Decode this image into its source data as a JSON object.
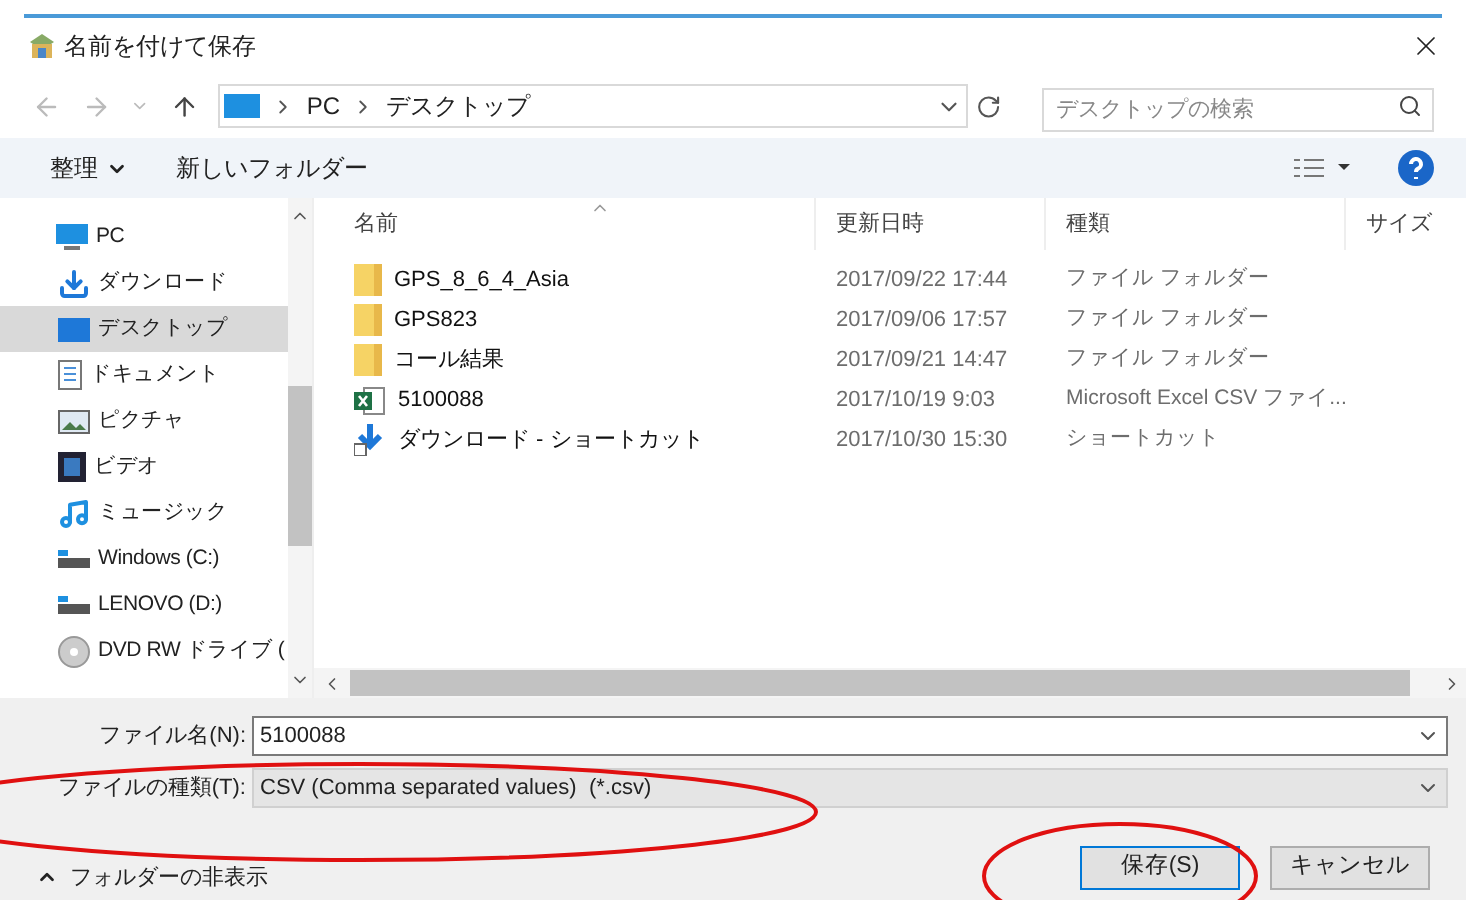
{
  "window": {
    "title": "名前を付けて保存"
  },
  "address_bar": {
    "path": [
      "PC",
      "デスクトップ"
    ]
  },
  "search": {
    "placeholder": "デスクトップの検索"
  },
  "toolbar": {
    "organize": "整理",
    "new_folder": "新しいフォルダー"
  },
  "sidebar": {
    "items": [
      {
        "label": "PC",
        "kind": "pc",
        "selected": false
      },
      {
        "label": "ダウンロード",
        "kind": "download",
        "selected": false
      },
      {
        "label": "デスクトップ",
        "kind": "desktop",
        "selected": true
      },
      {
        "label": "ドキュメント",
        "kind": "document",
        "selected": false
      },
      {
        "label": "ピクチャ",
        "kind": "picture",
        "selected": false
      },
      {
        "label": "ビデオ",
        "kind": "video",
        "selected": false
      },
      {
        "label": "ミュージック",
        "kind": "music",
        "selected": false
      },
      {
        "label": "Windows (C:)",
        "kind": "drive",
        "selected": false
      },
      {
        "label": "LENOVO (D:)",
        "kind": "drive",
        "selected": false
      },
      {
        "label": "DVD RW ドライブ (",
        "kind": "disc",
        "selected": false
      }
    ]
  },
  "table": {
    "columns": [
      "名前",
      "更新日時",
      "種類",
      "サイズ"
    ],
    "rows": [
      {
        "kind": "folder",
        "name": "GPS_8_6_4_Asia",
        "modified": "2017/09/22 17:44",
        "type": "ファイル フォルダー"
      },
      {
        "kind": "folder",
        "name": "GPS823",
        "modified": "2017/09/06 17:57",
        "type": "ファイル フォルダー"
      },
      {
        "kind": "folder",
        "name": "コール結果",
        "modified": "2017/09/21 14:47",
        "type": "ファイル フォルダー"
      },
      {
        "kind": "excel",
        "name": "5100088",
        "modified": "2017/10/19 9:03",
        "type": "Microsoft Excel CSV ファイ..."
      },
      {
        "kind": "shortcut",
        "name": "ダウンロード - ショートカット",
        "modified": "2017/10/30 15:30",
        "type": "ショートカット"
      }
    ]
  },
  "form": {
    "filename_label": "ファイル名(N):",
    "filename": "5100088",
    "filetype_label": "ファイルの種類(T):",
    "filetype": "CSV (Comma separated values)  (*.csv)"
  },
  "hide_folders": "フォルダーの非表示",
  "buttons": [
    {
      "label": "保存(S)",
      "kind": "primary"
    },
    {
      "label": "キャンセル",
      "kind": "normal"
    }
  ]
}
